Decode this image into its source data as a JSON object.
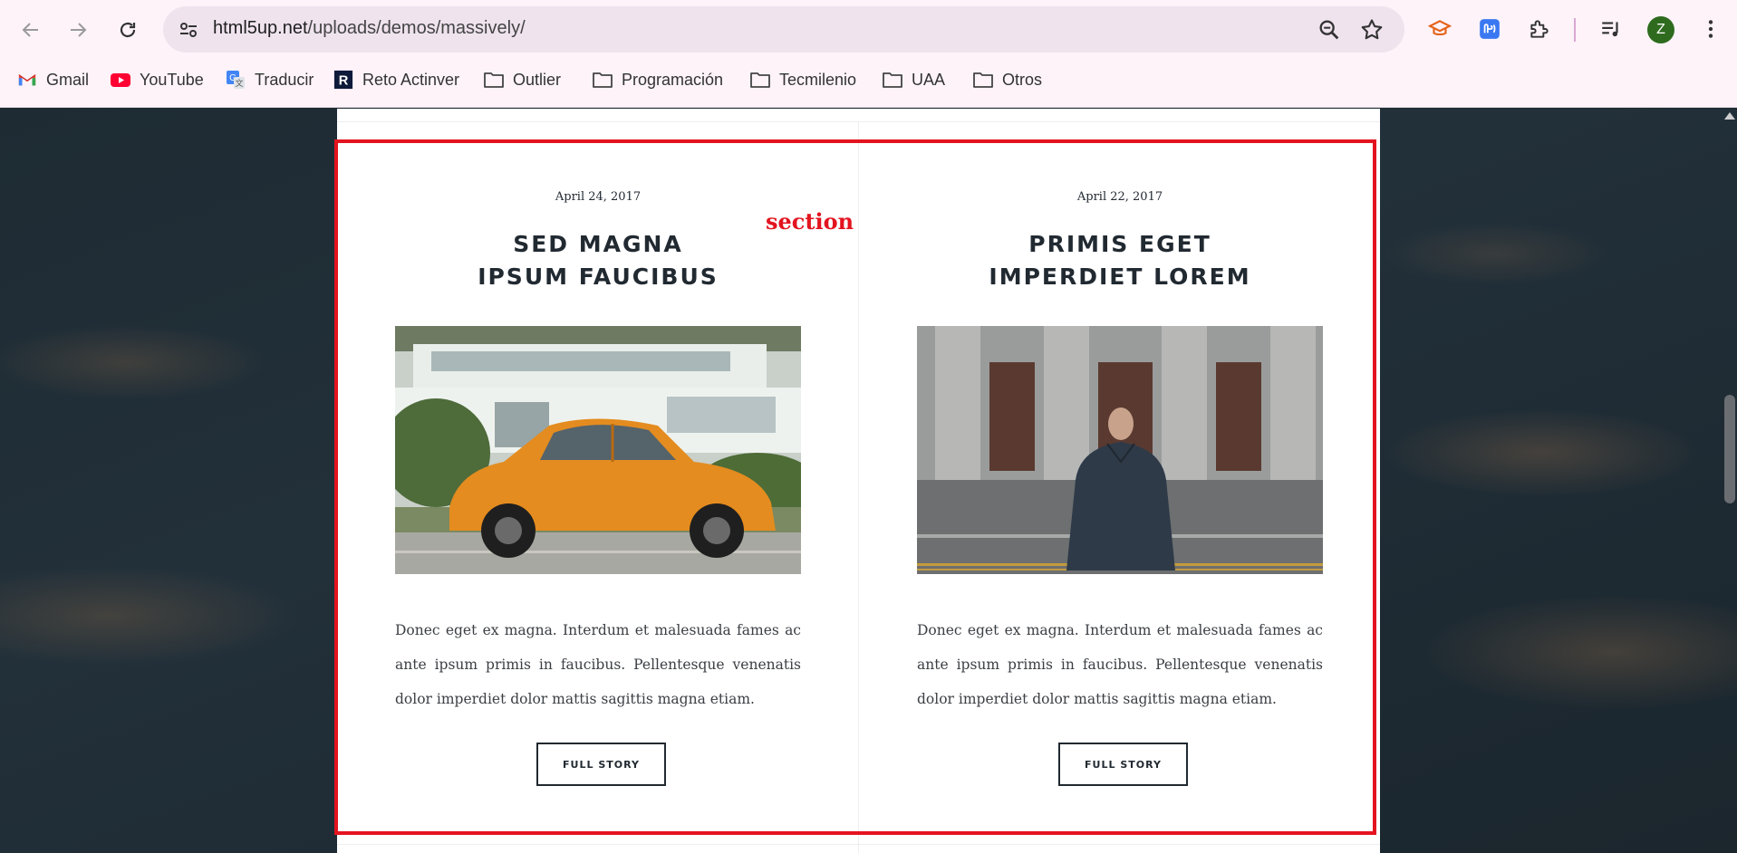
{
  "browser": {
    "url_host": "html5up.net",
    "url_path": "/uploads/demos/massively/",
    "profile_initial": "Z"
  },
  "bookmarks": [
    {
      "label": "Gmail",
      "icon": "gmail-icon"
    },
    {
      "label": "YouTube",
      "icon": "youtube-icon"
    },
    {
      "label": "Traducir",
      "icon": "translate-icon"
    },
    {
      "label": "Reto Actinver",
      "icon": "reto-actinver-icon"
    },
    {
      "label": "Outlier",
      "icon": "folder-icon"
    },
    {
      "label": "Programación",
      "icon": "folder-icon"
    },
    {
      "label": "Tecmilenio",
      "icon": "folder-icon"
    },
    {
      "label": "UAA",
      "icon": "folder-icon"
    },
    {
      "label": "Otros",
      "icon": "folder-icon"
    }
  ],
  "annotation": {
    "label": "section",
    "color": "#e3141f"
  },
  "posts": [
    {
      "date": "April 24, 2017",
      "title_line1": "SED MAGNA",
      "title_line2": "IPSUM FAUCIBUS",
      "image": "orange-beetle-car-photo",
      "text": "Donec eget ex magna. Interdum et malesuada fames ac ante ipsum primis in faucibus. Pellentesque venenatis dolor imperdiet dolor mattis sagittis magna etiam.",
      "button": "FULL STORY"
    },
    {
      "date": "April 22, 2017",
      "title_line1": "PRIMIS EGET",
      "title_line2": "IMPERDIET LOREM",
      "image": "man-in-suit-photo",
      "text": "Donec eget ex magna. Interdum et malesuada fames ac ante ipsum primis in faucibus. Pellentesque venenatis dolor imperdiet dolor mattis sagittis magna etiam.",
      "button": "FULL STORY"
    }
  ]
}
